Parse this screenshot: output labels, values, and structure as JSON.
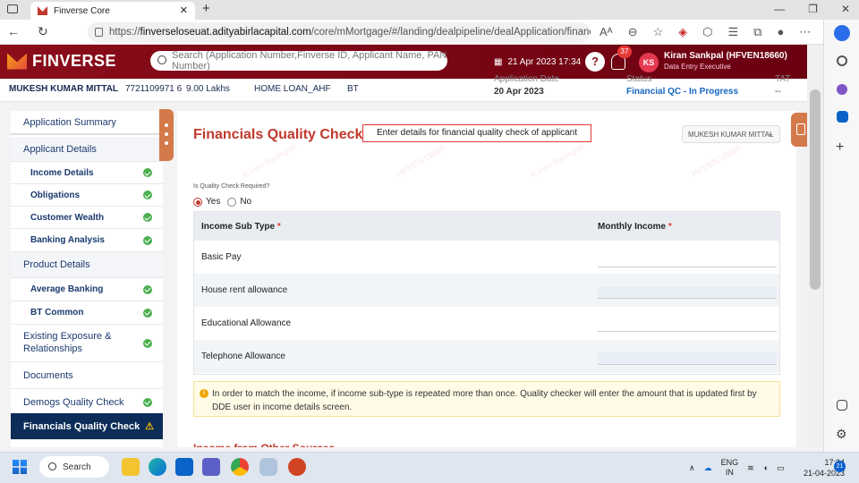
{
  "browser": {
    "tab_title": "Finverse Core",
    "new_tab": "+",
    "url_prefix": "https://",
    "url_host": "finverseloseuat.adityabirlacapital.com",
    "url_path": "/core/mMortgage/#/landing/dealpipeline/dealApplication/financi...",
    "reader_label": "Aᴬ"
  },
  "header": {
    "brand": "FINVERSE",
    "search_placeholder": "Search (Application Number,Finverse ID, Applicant Name, PAN Number)",
    "datetime": "21 Apr 2023 17:34",
    "notif_count": "37",
    "avatar_initials": "KS",
    "user_name": "Kiran Sankpal (HFVEN18660)",
    "user_role": "Data Entry Executive"
  },
  "summary": {
    "applicant": "MUKESH KUMAR MITTAL",
    "phone": "7721109971 6",
    "amount": "9.00 Lakhs",
    "product": "HOME LOAN_AHF",
    "type": "BT",
    "app_date_label": "Application Date",
    "app_date": "20 Apr 2023",
    "status_label": "Status",
    "status": "Financial QC - In Progress",
    "tat_label": "TAT",
    "tat": "--"
  },
  "sidebar": {
    "items": [
      {
        "label": "Application Summary"
      },
      {
        "label": "Applicant Details"
      },
      {
        "label": "Income Details"
      },
      {
        "label": "Obligations"
      },
      {
        "label": "Customer Wealth"
      },
      {
        "label": "Banking Analysis"
      },
      {
        "label": "Product Details"
      },
      {
        "label": "Average Banking"
      },
      {
        "label": "BT Common"
      },
      {
        "label": "Existing Exposure & Relationships"
      },
      {
        "label": "Documents"
      },
      {
        "label": "Demogs Quality Check"
      },
      {
        "label": "Financials Quality Check"
      }
    ]
  },
  "main": {
    "title": "Financials Quality Check",
    "annotation": "Enter details for financial quality check of applicant",
    "applicant_select": "MUKESH KUMAR MITTAL",
    "qc_question": "Is Quality Check Required?",
    "yes": "Yes",
    "no": "No",
    "col_income_sub_type": "Income Sub Type",
    "col_monthly_income": "Monthly Income",
    "required_mark": "*",
    "rows": [
      {
        "sub_type": "Basic Pay"
      },
      {
        "sub_type": "House rent allowance"
      },
      {
        "sub_type": "Educational Allowance"
      },
      {
        "sub_type": "Telephone Allowance"
      }
    ],
    "note": "In order to match the income, if income sub-type is repeated more than once. Quality checker will enter the amount that is updated first by DDE user in income details screen.",
    "other_sources": "Income from Other Sources",
    "watermark_1": "Kiran Sankpal",
    "watermark_2": "HFVEN18660"
  },
  "taskbar": {
    "search": "Search",
    "lang": "ENG",
    "region": "IN",
    "time": "17:34",
    "date": "21-04-2023",
    "notif": "21"
  },
  "colors": {
    "brand": "#8a0d1a",
    "title_red": "#c0392b",
    "sidebar_active": "#0b2d57",
    "success": "#4caf50"
  }
}
